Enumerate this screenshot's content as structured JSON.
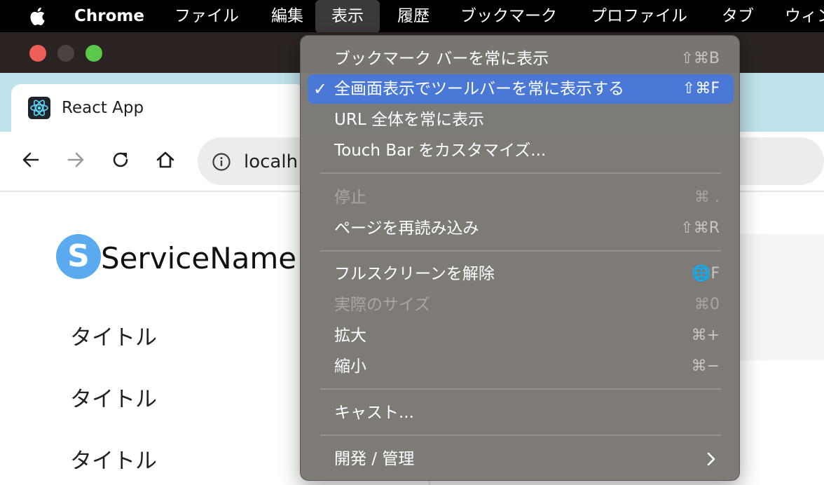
{
  "menubar": {
    "app": "Chrome",
    "items": [
      "ファイル",
      "編集",
      "表示",
      "履歴",
      "ブックマーク",
      "プロファイル",
      "タブ",
      "ウィン"
    ],
    "active": "表示"
  },
  "window": {
    "traffic_lights": [
      "#ee5f57",
      "#4b4342",
      "#5ac84b"
    ]
  },
  "tab": {
    "title": "React App",
    "favicon_icon": "react-logo-icon"
  },
  "toolbar": {
    "url_text": "localh"
  },
  "page": {
    "logo_letter": "S",
    "brand": "ServiceName",
    "nav_items": [
      "タイトル",
      "タイトル",
      "タイトル"
    ]
  },
  "view_menu": {
    "items": [
      {
        "label": "ブックマーク バーを常に表示",
        "shortcut": "⇧⌘B"
      },
      {
        "label": "全画面表示でツールバーを常に表示する",
        "shortcut": "⇧⌘F",
        "checked": "✓"
      },
      {
        "label": "URL 全体を常に表示",
        "shortcut": ""
      },
      {
        "label": "Touch Bar をカスタマイズ...",
        "shortcut": ""
      },
      {
        "label": "停止",
        "shortcut": "⌘ ."
      },
      {
        "label": "ページを再読み込み",
        "shortcut": "⇧⌘R"
      },
      {
        "label": "フルスクリーンを解除",
        "shortcut": "🌐F"
      },
      {
        "label": "実際のサイズ",
        "shortcut": "⌘0"
      },
      {
        "label": "拡大",
        "shortcut": "⌘+"
      },
      {
        "label": "縮小",
        "shortcut": "⌘−"
      },
      {
        "label": "キャスト...",
        "shortcut": ""
      },
      {
        "label": "開発 / 管理",
        "shortcut": ""
      }
    ]
  },
  "colors": {
    "menu_highlight": "#4a78d6",
    "menu_bg": "#7b7874",
    "tab_strip": "#bfe3ec",
    "logo": "#5aaaf0"
  }
}
